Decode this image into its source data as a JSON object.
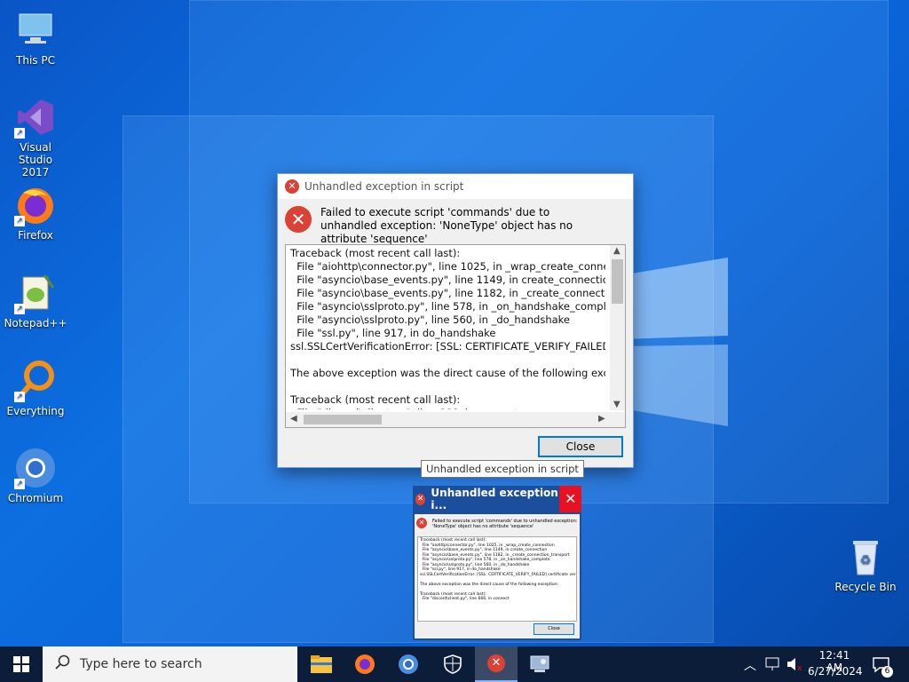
{
  "desktop": {
    "icons": [
      {
        "label": "This PC",
        "icon": "computer-icon"
      },
      {
        "label": "Visual Studio 2017",
        "icon": "visual-studio-icon"
      },
      {
        "label": "Firefox",
        "icon": "firefox-icon"
      },
      {
        "label": "Notepad++",
        "icon": "notepad-plus-plus-icon"
      },
      {
        "label": "Everything",
        "icon": "everything-search-icon"
      },
      {
        "label": "Chromium",
        "icon": "chromium-icon"
      },
      {
        "label": "Recycle Bin",
        "icon": "recycle-bin-icon"
      }
    ]
  },
  "dialog": {
    "title": "Unhandled exception in script",
    "message": "Failed to execute script 'commands' due to unhandled exception: 'NoneType' object has no attribute 'sequence'",
    "traceback": "Traceback (most recent call last):\n  File \"aiohttp\\connector.py\", line 1025, in _wrap_create_connection\n  File \"asyncio\\base_events.py\", line 1149, in create_connection\n  File \"asyncio\\base_events.py\", line 1182, in _create_connection_transport\n  File \"asyncio\\sslproto.py\", line 578, in _on_handshake_complete\n  File \"asyncio\\sslproto.py\", line 560, in _do_handshake\n  File \"ssl.py\", line 917, in do_handshake\nssl.SSLCertVerificationError: [SSL: CERTIFICATE_VERIFY_FAILED] certificate verify failed\n\nThe above exception was the direct cause of the following exception:\n\nTraceback (most recent call last):\n  File \"discord\\client.py\", line 666, in connect",
    "close_label": "Close"
  },
  "tooltip": {
    "text": "Unhandled exception in script"
  },
  "taskbar_preview": {
    "title": "Unhandled exception i...",
    "close_glyph": "✕",
    "close_label": "Close"
  },
  "taskbar": {
    "search_placeholder": "Type here to search",
    "apps": [
      "file-explorer-icon",
      "firefox-icon",
      "chromium-icon",
      "security-shield-icon",
      "error-app-icon",
      "control-panel-icon"
    ],
    "clock_time": "12:41 AM",
    "clock_date": "6/27/2024",
    "notification_count": "6"
  },
  "colors": {
    "accent": "#0078d7",
    "error": "#d94234",
    "taskbar": "#0c1d3a"
  }
}
